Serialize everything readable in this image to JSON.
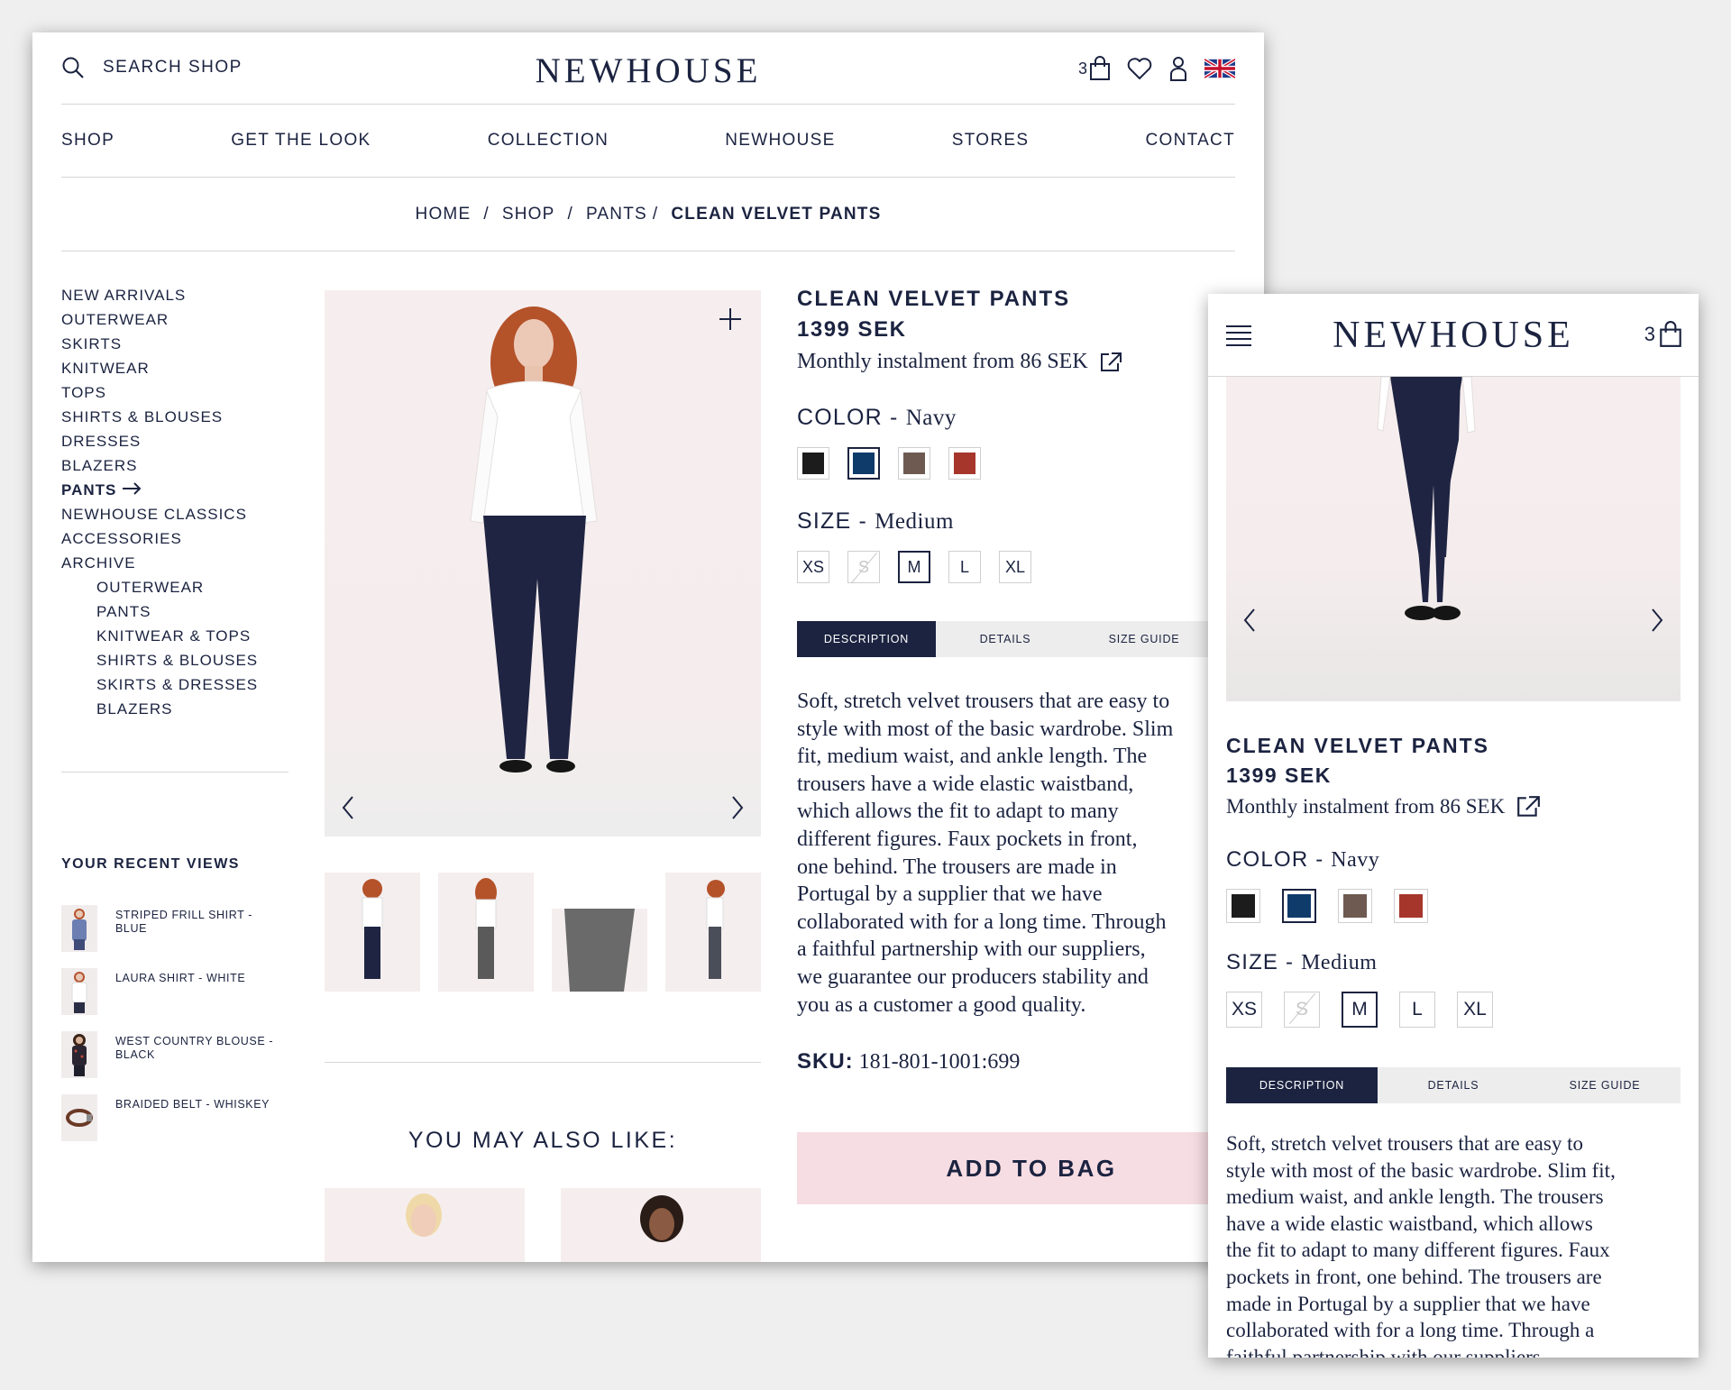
{
  "brand": "NEWHOUSE",
  "header": {
    "search_label": "SEARCH SHOP",
    "bag_count": "3",
    "locale_flag": "uk-flag-icon"
  },
  "nav": [
    "SHOP",
    "GET THE LOOK",
    "COLLECTION",
    "NEWHOUSE",
    "STORES",
    "CONTACT"
  ],
  "breadcrumb": [
    "HOME",
    "/",
    "SHOP",
    "/",
    "PANTS",
    "/",
    "CLEAN VELVET PANTS"
  ],
  "sidebar": {
    "items": [
      {
        "label": "NEW ARRIVALS",
        "sub": false,
        "active": false
      },
      {
        "label": "OUTERWEAR",
        "sub": false,
        "active": false
      },
      {
        "label": "SKIRTS",
        "sub": false,
        "active": false
      },
      {
        "label": "KNITWEAR",
        "sub": false,
        "active": false
      },
      {
        "label": "TOPS",
        "sub": false,
        "active": false
      },
      {
        "label": "SHIRTS & BLOUSES",
        "sub": false,
        "active": false
      },
      {
        "label": "DRESSES",
        "sub": false,
        "active": false
      },
      {
        "label": "BLAZERS",
        "sub": false,
        "active": false
      },
      {
        "label": "PANTS",
        "sub": false,
        "active": true
      },
      {
        "label": "NEWHOUSE CLASSICS",
        "sub": false,
        "active": false
      },
      {
        "label": "ACCESSORIES",
        "sub": false,
        "active": false
      },
      {
        "label": "ARCHIVE",
        "sub": false,
        "active": false
      },
      {
        "label": "OUTERWEAR",
        "sub": true,
        "active": false
      },
      {
        "label": "PANTS",
        "sub": true,
        "active": false
      },
      {
        "label": "KNITWEAR & TOPS",
        "sub": true,
        "active": false
      },
      {
        "label": "SHIRTS & BLOUSES",
        "sub": true,
        "active": false
      },
      {
        "label": "SKIRTS & DRESSES",
        "sub": true,
        "active": false
      },
      {
        "label": "BLAZERS",
        "sub": true,
        "active": false
      }
    ],
    "recent_title": "YOUR RECENT VIEWS",
    "recent": [
      {
        "label": "STRIPED FRILL SHIRT - BLUE",
        "color": "#6c7fb2"
      },
      {
        "label": "LAURA SHIRT - WHITE",
        "color": "#ffffff"
      },
      {
        "label": "WEST COUNTRY BLOUSE - BLACK",
        "color": "#2a2530"
      },
      {
        "label": "BRAIDED BELT - WHISKEY",
        "color": "#6a3a26"
      }
    ]
  },
  "product": {
    "name": "CLEAN VELVET PANTS",
    "price": "1399 SEK",
    "instalment": "Monthly instalment from 86 SEK",
    "color_label": "COLOR -",
    "color_value": "Navy",
    "colors": [
      "#1c1c1c",
      "#0f3b6b",
      "#6e5a50",
      "#a6362b"
    ],
    "selected_color": 1,
    "size_label": "SIZE -",
    "size_value": "Medium",
    "sizes": [
      {
        "label": "XS",
        "state": "available"
      },
      {
        "label": "S",
        "state": "unavailable"
      },
      {
        "label": "M",
        "state": "selected"
      },
      {
        "label": "L",
        "state": "available"
      },
      {
        "label": "XL",
        "state": "available"
      }
    ],
    "tabs": [
      "DESCRIPTION",
      "DETAILS",
      "SIZE GUIDE"
    ],
    "description_lines_desktop": [
      "Soft, stretch velvet trousers that are easy to",
      "style with most of the basic wardrobe. Slim",
      "fit, medium waist, and ankle length. The",
      "trousers have a wide elastic waistband,",
      "which allows the fit to adapt to many",
      "different figures. Faux pockets in front,",
      "one behind. The trousers are made in",
      "Portugal by a supplier that we have",
      "collaborated with for a long time. Through",
      "a faithful partnership with our suppliers,",
      "we guarantee our producers stability and",
      "you as a customer a good quality."
    ],
    "description_lines_mobile": [
      "Soft, stretch velvet trousers that are easy to",
      "style with most of the basic wardrobe. Slim fit,",
      "medium waist, and ankle length. The trousers",
      "have a wide elastic waistband, which allows",
      "the fit to adapt to many different figures. Faux",
      "pockets in front, one behind. The trousers are",
      "made in Portugal by a supplier that we have",
      "collaborated with for a long time. Through a",
      "faithful partnership with our suppliers"
    ],
    "sku_label": "SKU:",
    "sku": "181-801-1001:699",
    "add_to_bag": "ADD TO BAG"
  },
  "you_may_also_like": "YOU MAY ALSO LIKE:",
  "colors": {
    "navy": "#1b2340",
    "bag_button": "#f6dde3",
    "photo_bg": "#f6eeee"
  }
}
